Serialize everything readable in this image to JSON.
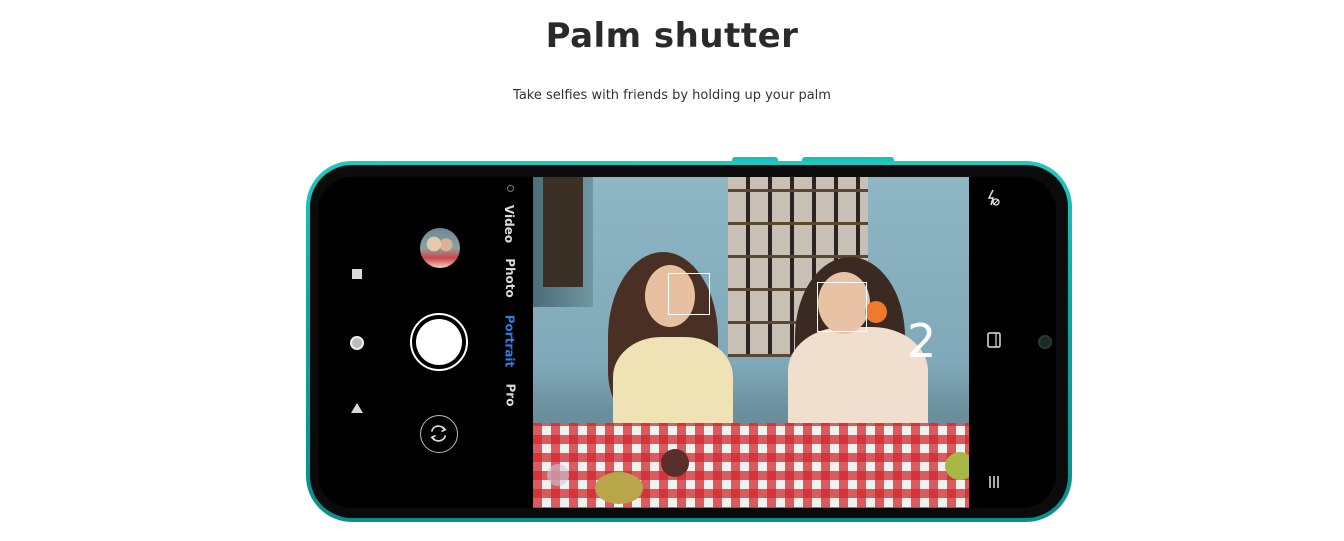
{
  "heading": {
    "title": "Palm shutter",
    "subtitle": "Take selfies with friends by holding up your palm"
  },
  "camera": {
    "modes": [
      {
        "label": "Video",
        "active": false
      },
      {
        "label": "Photo",
        "active": false
      },
      {
        "label": "Portrait",
        "active": true
      },
      {
        "label": "Pro",
        "active": false
      }
    ],
    "countdown": "2",
    "accent_color": "#2f7de1",
    "icons": {
      "nav_square": "square-nav-icon",
      "nav_circle": "circle-nav-icon",
      "nav_back": "triangle-nav-icon",
      "shutter": "shutter-button",
      "flip": "camera-flip-icon",
      "gallery": "gallery-thumbnail",
      "flash": "flash-off-icon",
      "aspect": "aspect-ratio-icon",
      "menu": "menu-lines-icon"
    }
  },
  "colors": {
    "phone_body": "#14b8b2",
    "active_mode": "#2f7de1"
  }
}
